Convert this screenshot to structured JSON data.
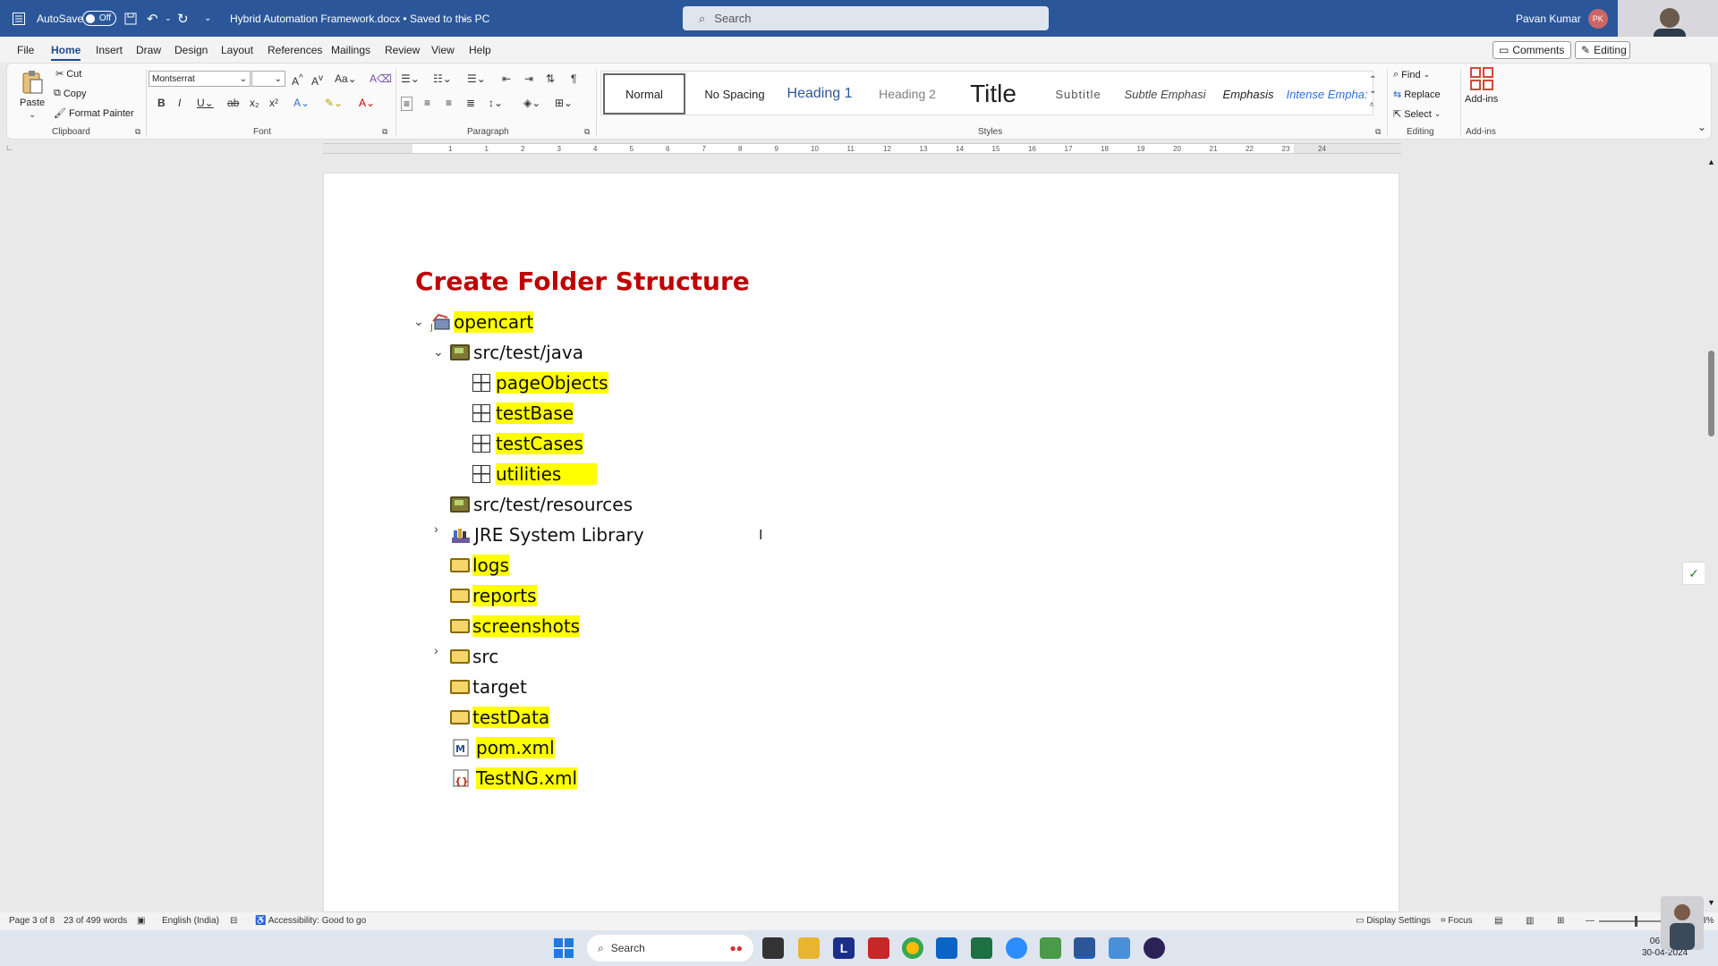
{
  "titlebar": {
    "autosave_label": "AutoSave",
    "autosave_state": "Off",
    "document_title": "Hybrid Automation Framework.docx • Saved to this PC",
    "search_placeholder": "Search",
    "user_name": "Pavan Kumar",
    "user_initials": "PK"
  },
  "menu": {
    "tabs": [
      "File",
      "Home",
      "Insert",
      "Draw",
      "Design",
      "Layout",
      "References",
      "Mailings",
      "Review",
      "View",
      "Help"
    ],
    "active_tab": "Home",
    "comments_label": "Comments",
    "editing_label": "Editing"
  },
  "ribbon": {
    "clipboard": {
      "paste": "Paste",
      "cut": "Cut",
      "copy": "Copy",
      "format_painter": "Format Painter",
      "group": "Clipboard"
    },
    "font": {
      "name": "Montserrat",
      "size": "",
      "group": "Font"
    },
    "paragraph": {
      "group": "Paragraph"
    },
    "styles": {
      "items": [
        "Normal",
        "No Spacing",
        "Heading 1",
        "Heading 2",
        "Title",
        "Subtitle",
        "Subtle Emphasi",
        "Emphasis",
        "Intense Empha:"
      ],
      "group": "Styles"
    },
    "editing": {
      "find": "Find",
      "replace": "Replace",
      "select": "Select",
      "group": "Editing"
    },
    "addins": {
      "label": "Add-ins",
      "group": "Add-ins"
    }
  },
  "ruler": {
    "ticks": [
      "1",
      "1",
      "2",
      "3",
      "4",
      "5",
      "6",
      "7",
      "8",
      "9",
      "10",
      "11",
      "12",
      "13",
      "14",
      "15",
      "16",
      "17",
      "18",
      "19",
      "20",
      "21",
      "22",
      "23",
      "24"
    ]
  },
  "document": {
    "heading": "Create Folder Structure",
    "tree": {
      "root": "opencart",
      "src_test_java": "src/test/java",
      "packages": [
        "pageObjects",
        "testBase",
        "testCases",
        "utilities"
      ],
      "src_test_resources": "src/test/resources",
      "jre": "JRE System Library",
      "folders": [
        "logs",
        "reports",
        "screenshots",
        "src",
        "target",
        "testData"
      ],
      "pom": "pom.xml",
      "testng": "TestNG.xml"
    }
  },
  "statusbar": {
    "page": "Page 3 of 8",
    "words": "23 of 499 words",
    "language": "English (India)",
    "accessibility": "Accessibility: Good to go",
    "display_settings": "Display Settings",
    "focus": "Focus",
    "zoom": "123%"
  },
  "taskbar": {
    "search": "Search",
    "time": "06:50 AM",
    "date": "30-04-2024"
  },
  "colors": {
    "titlebar": "#2b579a",
    "heading": "#c00000",
    "highlight": "#ffff00"
  }
}
